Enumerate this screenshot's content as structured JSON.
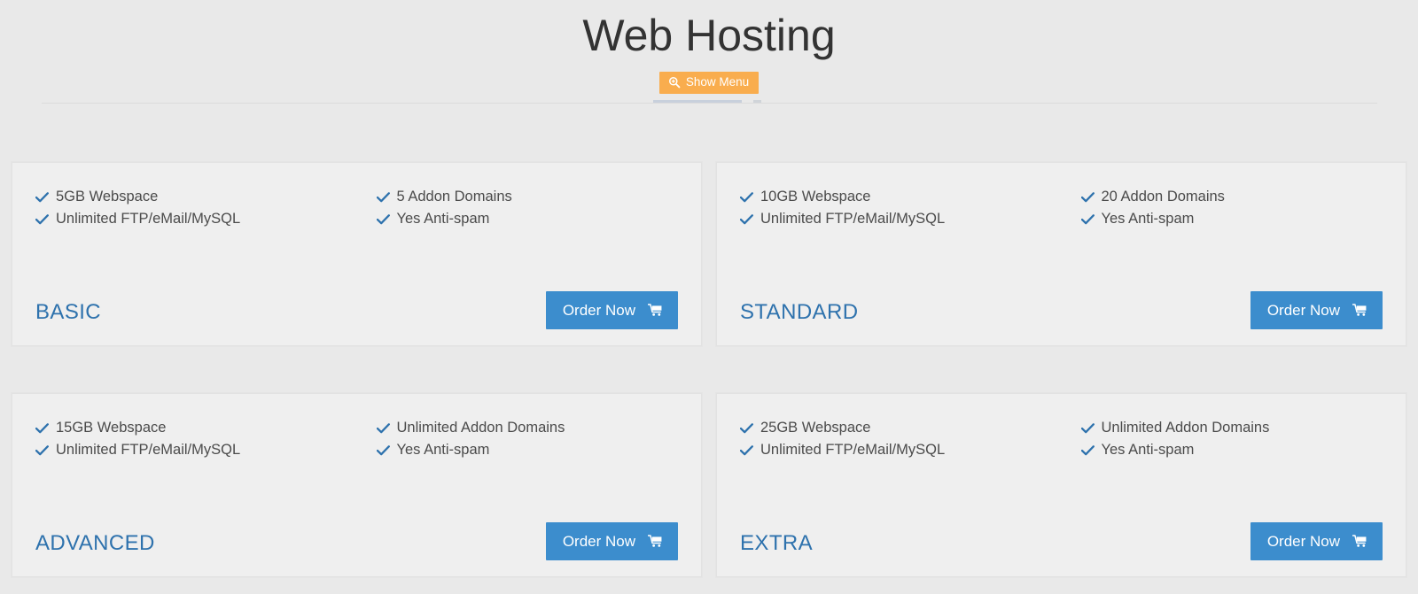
{
  "header": {
    "title": "Web Hosting",
    "menu_button": {
      "label": "Show Menu",
      "icon": "search-plus-icon",
      "color": "#f9ad4e"
    }
  },
  "theme": {
    "page_background": "#e9e9e9",
    "card_background": "#efefef",
    "accent_blue": "#3c8dcd",
    "title_blue": "#2e72ad",
    "check_blue": "#2e72ad",
    "heading_gray": "#333333",
    "divider": "#dcdcdc"
  },
  "plans": [
    {
      "name": "BASIC",
      "features_left": [
        "5GB Webspace",
        "Unlimited FTP/eMail/MySQL"
      ],
      "features_right": [
        "5 Addon Domains",
        "Yes Anti-spam"
      ],
      "order_label": "Order Now",
      "order_icon": "shopping-cart-icon"
    },
    {
      "name": "STANDARD",
      "features_left": [
        "10GB Webspace",
        "Unlimited FTP/eMail/MySQL"
      ],
      "features_right": [
        "20 Addon Domains",
        "Yes Anti-spam"
      ],
      "order_label": "Order Now",
      "order_icon": "shopping-cart-icon"
    },
    {
      "name": "ADVANCED",
      "features_left": [
        "15GB Webspace",
        "Unlimited FTP/eMail/MySQL"
      ],
      "features_right": [
        "Unlimited Addon Domains",
        "Yes Anti-spam"
      ],
      "order_label": "Order Now",
      "order_icon": "shopping-cart-icon"
    },
    {
      "name": "EXTRA",
      "features_left": [
        "25GB Webspace",
        "Unlimited FTP/eMail/MySQL"
      ],
      "features_right": [
        "Unlimited Addon Domains",
        "Yes Anti-spam"
      ],
      "order_label": "Order Now",
      "order_icon": "shopping-cart-icon"
    }
  ]
}
